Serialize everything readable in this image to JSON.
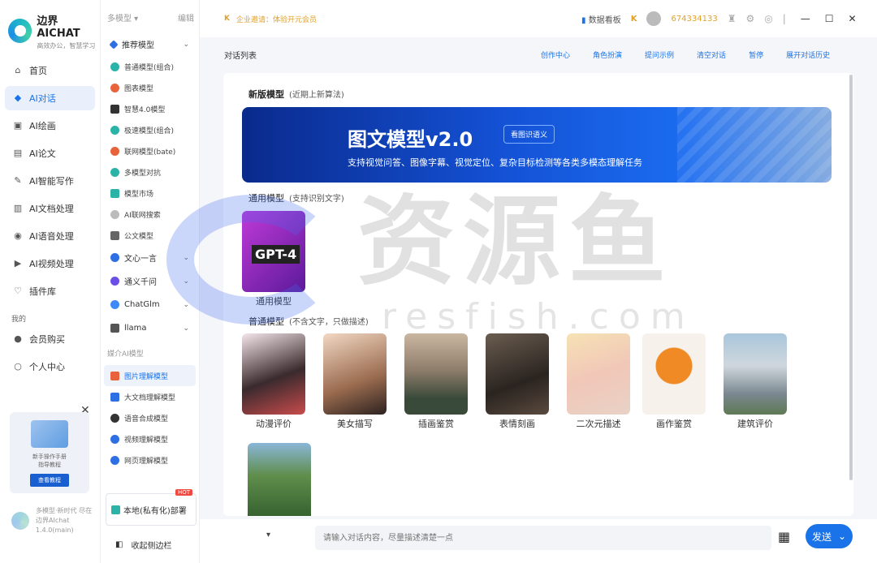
{
  "brand": {
    "title": "边界AICHAT",
    "subtitle": "高效办公，智慧学习"
  },
  "nav": {
    "items": [
      {
        "label": "首页",
        "icon": "home-icon"
      },
      {
        "label": "AI对话",
        "icon": "cube-icon"
      },
      {
        "label": "AI绘画",
        "icon": "image-icon"
      },
      {
        "label": "AI论文",
        "icon": "document-icon"
      },
      {
        "label": "AI智能写作",
        "icon": "pen-icon"
      },
      {
        "label": "AI文档处理",
        "icon": "file-icon"
      },
      {
        "label": "AI语音处理",
        "icon": "speaker-icon"
      },
      {
        "label": "AI视频处理",
        "icon": "video-icon"
      },
      {
        "label": "插件库",
        "icon": "plugin-icon"
      }
    ],
    "section_mine": "我的",
    "mine_items": [
      {
        "label": "会员购买",
        "icon": "user-icon"
      },
      {
        "label": "个人中心",
        "icon": "profile-icon"
      }
    ]
  },
  "promo": {
    "text": "新手操作手册\n指导教程",
    "button": "查看教程"
  },
  "version": {
    "text": "多模型·新时代 尽在边界AIchat 1.4.0(main)"
  },
  "modelcol": {
    "head_left": "多模型 ▾",
    "head_right": "编辑",
    "recommend": "推荐模型",
    "items": [
      {
        "label": "普通模型(组合)",
        "color": "#2bb3a8"
      },
      {
        "label": "图表模型",
        "color": "#e8623c"
      },
      {
        "label": "智慧4.0模型",
        "color": "#333333"
      },
      {
        "label": "极速模型(组合)",
        "color": "#2bb3a8"
      },
      {
        "label": "联网模型(bate)",
        "color": "#e8623c"
      },
      {
        "label": "多模型对抗",
        "color": "#2bb3a8"
      },
      {
        "label": "模型市场",
        "color": "#2bb3a8"
      },
      {
        "label": "AI联网搜索",
        "color": "#999999"
      },
      {
        "label": "公文模型",
        "color": "#666666"
      }
    ],
    "groups": [
      {
        "label": "文心一言",
        "color": "#2f6fe4"
      },
      {
        "label": "通义千问",
        "color": "#6b4ee6"
      },
      {
        "label": "ChatGlm",
        "color": "#3d8af7"
      },
      {
        "label": "llama",
        "color": "#555555"
      }
    ],
    "media_section": "媒介AI模型",
    "media_items": [
      {
        "label": "图片理解模型",
        "color": "#e8623c"
      },
      {
        "label": "大文档理解模型",
        "color": "#2f6fe4"
      },
      {
        "label": "语音合成模型",
        "color": "#333333"
      },
      {
        "label": "视频理解模型",
        "color": "#2f6fe4"
      },
      {
        "label": "网页理解模型",
        "color": "#2f6fe4"
      }
    ],
    "deploy": "本地(私有化)部署",
    "hot": "HOT",
    "collapse": "收起侧边栏"
  },
  "topbar": {
    "notice": "企业邀请：体验开元会员",
    "dashboard": "数据看板",
    "user_id": "674334133"
  },
  "main": {
    "title": "对话列表",
    "links": [
      "创作中心",
      "角色扮演",
      "提问示例",
      "清空对话",
      "暂停",
      "展开对话历史"
    ]
  },
  "content": {
    "new_model": {
      "title": "新版模型",
      "sub": "(近期上新算法)"
    },
    "banner": {
      "title": "图文模型v2.0",
      "tag": "看图识语义",
      "desc": "支持视觉问答、图像字幕、视觉定位、复杂目标检测等各类多模态理解任务"
    },
    "general": {
      "title": "通用模型",
      "sub": "(支持识别文字)"
    },
    "gpt": {
      "thumb_text": "GPT-4",
      "label": "通用模型"
    },
    "normal": {
      "title": "普通模型",
      "sub": "(不含文字，只做描述)"
    },
    "cards": [
      {
        "label": "动漫评价"
      },
      {
        "label": "美女描写"
      },
      {
        "label": "插画鉴赏"
      },
      {
        "label": "表情刻画"
      },
      {
        "label": "二次元描述"
      },
      {
        "label": "画作鉴赏"
      },
      {
        "label": "建筑评价"
      },
      {
        "label": ""
      }
    ]
  },
  "input": {
    "placeholder": "请输入对话内容，尽量描述清楚一点",
    "send": "发送"
  },
  "watermark": {
    "cn": "资源鱼",
    "en": "resfish.com"
  }
}
